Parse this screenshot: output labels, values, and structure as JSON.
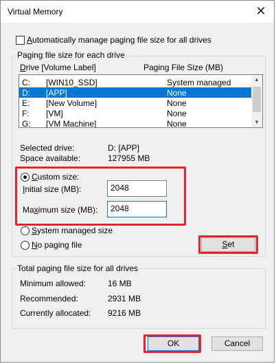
{
  "window": {
    "title": "Virtual Memory",
    "close_icon": "close-icon"
  },
  "auto_manage": {
    "label_pre": "",
    "label_ul": "A",
    "label_post": "utomatically manage paging file size for all drives",
    "checked": false
  },
  "paging_group": {
    "title": "Paging file size for each drive",
    "col_drive_ul": "D",
    "col_drive_post": "rive  [Volume Label]",
    "col_size": "Paging File Size (MB)",
    "drives": [
      {
        "letter": "C:",
        "label": "[WIN10_SSD]",
        "size": "System managed",
        "selected": false
      },
      {
        "letter": "D:",
        "label": "[APP]",
        "size": "None",
        "selected": true
      },
      {
        "letter": "E:",
        "label": "[New Volume]",
        "size": "None",
        "selected": false
      },
      {
        "letter": "F:",
        "label": "[VM]",
        "size": "None",
        "selected": false
      },
      {
        "letter": "G:",
        "label": "[VM Machine]",
        "size": "None",
        "selected": false
      }
    ],
    "selected_drive_label": "Selected drive:",
    "selected_drive_value": "D:  [APP]",
    "space_available_label": "Space available:",
    "space_available_value": "127955 MB",
    "custom_size_ul": "C",
    "custom_size_post": "ustom size:",
    "initial_size_ul": "I",
    "initial_size_post": "nitial size (MB):",
    "initial_size_value": "2048",
    "max_size_pre": "Ma",
    "max_size_ul": "x",
    "max_size_post": "imum size (MB):",
    "max_size_value": "2048",
    "system_managed_ul": "S",
    "system_managed_post": "ystem managed size",
    "no_paging_ul": "N",
    "no_paging_post": "o paging file",
    "set_ul": "S",
    "set_post": "et",
    "size_mode": "custom"
  },
  "total_group": {
    "title": "Total paging file size for all drives",
    "min_label": "Minimum allowed:",
    "min_value": "16 MB",
    "rec_label": "Recommended:",
    "rec_value": "2931 MB",
    "cur_label": "Currently allocated:",
    "cur_value": "9216 MB"
  },
  "buttons": {
    "ok": "OK",
    "cancel": "Cancel"
  },
  "highlight_color": "#e8242b",
  "selection_color": "#0078d7"
}
